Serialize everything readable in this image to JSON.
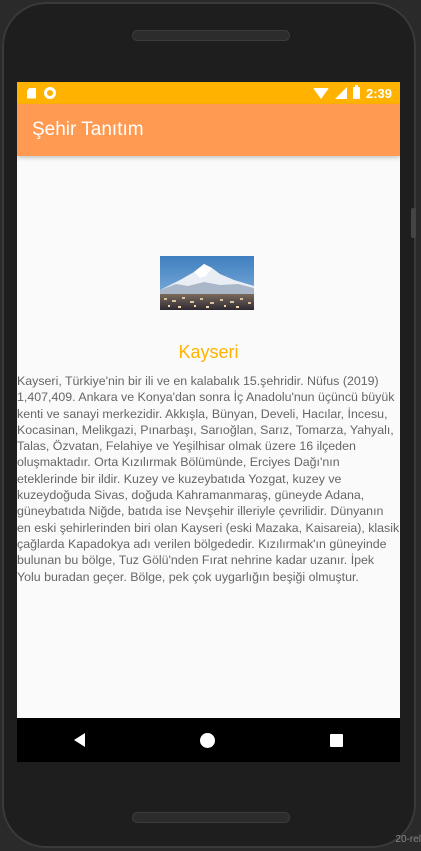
{
  "status_bar": {
    "time": "2:39",
    "icons": [
      "sd-card-icon",
      "notification-circle-icon",
      "wifi-icon",
      "signal-icon",
      "battery-icon"
    ],
    "background_color": "#ffb300"
  },
  "toolbar": {
    "title": "Şehir Tanıtım",
    "background_color": "#ff9a52"
  },
  "city": {
    "image_icon": "mountain-city-image",
    "name": "Kayseri",
    "name_color": "#ffb300",
    "description": "Kayseri, Türkiye'nin bir ili ve en kalabalık 15.şehridir. Nüfus (2019) 1,407,409. Ankara ve Konya'dan sonra İç Anadolu'nun üçüncü büyük kenti ve sanayi merkezidir. Akkışla, Bünyan, Develi, Hacılar, İncesu, Kocasinan, Melikgazi, Pınarbaşı, Sarıoğlan, Sarız, Tomarza, Yahyalı, Talas, Özvatan, Felahiye ve Yeşilhisar olmak üzere 16 ilçeden oluşmaktadır. Orta Kızılırmak Bölümünde, Erciyes Dağı'nın eteklerinde bir ildir. Kuzey ve kuzeybatıda Yozgat, kuzey ve kuzeydoğuda Sivas, doğuda Kahramanmaraş, güneyde Adana, güneybatıda Niğde, batıda ise Nevşehir illeriyle çevrilidir. Dünyanın en eski şehirlerinden biri olan Kayseri (eski Mazaka, Kaisareia), klasik çağlarda Kapadokya adı verilen bölgededir. Kızılırmak'ın güneyinde bulunan bu bölge, Tuz Gölü'nden Fırat nehrine kadar uzanır. İpek Yolu buradan geçer. Bölge, pek çok uygarlığın beşiği olmuştur."
  },
  "nav_bar": {
    "buttons": [
      "back-icon",
      "home-icon",
      "recents-icon"
    ]
  },
  "corner_label": "20-rel"
}
